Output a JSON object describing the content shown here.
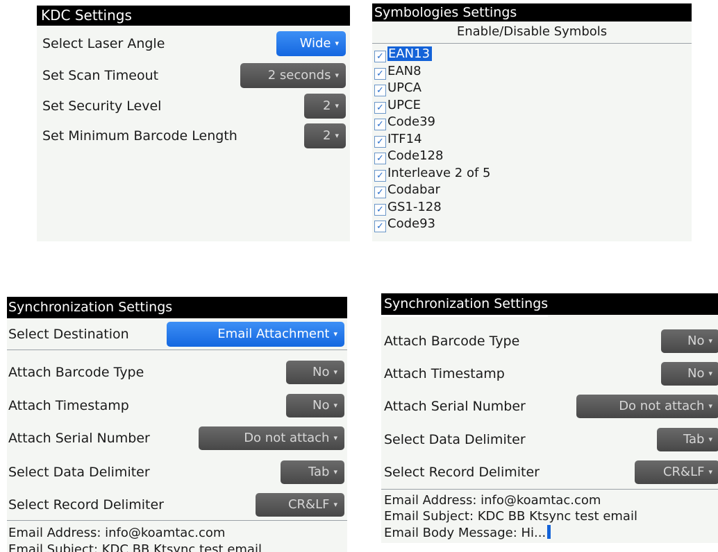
{
  "kdc": {
    "title": "KDC Settings",
    "rows": [
      {
        "label": "Select Laser Angle",
        "value": "Wide"
      },
      {
        "label": "Set Scan Timeout",
        "value": "2 seconds"
      },
      {
        "label": "Set Security Level",
        "value": "2"
      },
      {
        "label": "Set Minimum Barcode Length",
        "value": "2"
      }
    ]
  },
  "symbologies": {
    "title": "Symbologies Settings",
    "subtitle": "Enable/Disable Symbols",
    "items": [
      {
        "label": "EAN13",
        "checked": true
      },
      {
        "label": "EAN8",
        "checked": true
      },
      {
        "label": "UPCA",
        "checked": true
      },
      {
        "label": "UPCE",
        "checked": true
      },
      {
        "label": "Code39",
        "checked": true
      },
      {
        "label": "ITF14",
        "checked": true
      },
      {
        "label": "Code128",
        "checked": true
      },
      {
        "label": "Interleave 2 of 5",
        "checked": true
      },
      {
        "label": "Codabar",
        "checked": true
      },
      {
        "label": "GS1-128",
        "checked": true
      },
      {
        "label": "Code93",
        "checked": true
      }
    ]
  },
  "sync_left": {
    "title": "Synchronization Settings",
    "rows": [
      {
        "label": "Select Destination",
        "value": "Email Attachment"
      },
      {
        "label": "Attach Barcode Type",
        "value": "No"
      },
      {
        "label": "Attach Timestamp",
        "value": "No"
      },
      {
        "label": "Attach Serial Number",
        "value": "Do not attach"
      },
      {
        "label": "Select Data Delimiter",
        "value": "Tab"
      },
      {
        "label": "Select Record Delimiter",
        "value": "CR&LF"
      }
    ],
    "email_address": "Email Address: info@koamtac.com",
    "email_subject_partial": "Email Subject: KDC BB Ktsync test email"
  },
  "sync_right": {
    "title": "Synchronization Settings",
    "rows": [
      {
        "label": "Attach Barcode Type",
        "value": "No"
      },
      {
        "label": "Attach Timestamp",
        "value": "No"
      },
      {
        "label": "Attach Serial Number",
        "value": "Do not attach"
      },
      {
        "label": "Select Data Delimiter",
        "value": "Tab"
      },
      {
        "label": "Select Record Delimiter",
        "value": "CR&LF"
      }
    ],
    "email_address": "Email Address: info@koamtac.com",
    "email_subject": "Email Subject: KDC BB Ktsync test email",
    "email_body": "Email Body Message: Hi..."
  },
  "caret_glyph": "▾",
  "check_glyph": "✓"
}
